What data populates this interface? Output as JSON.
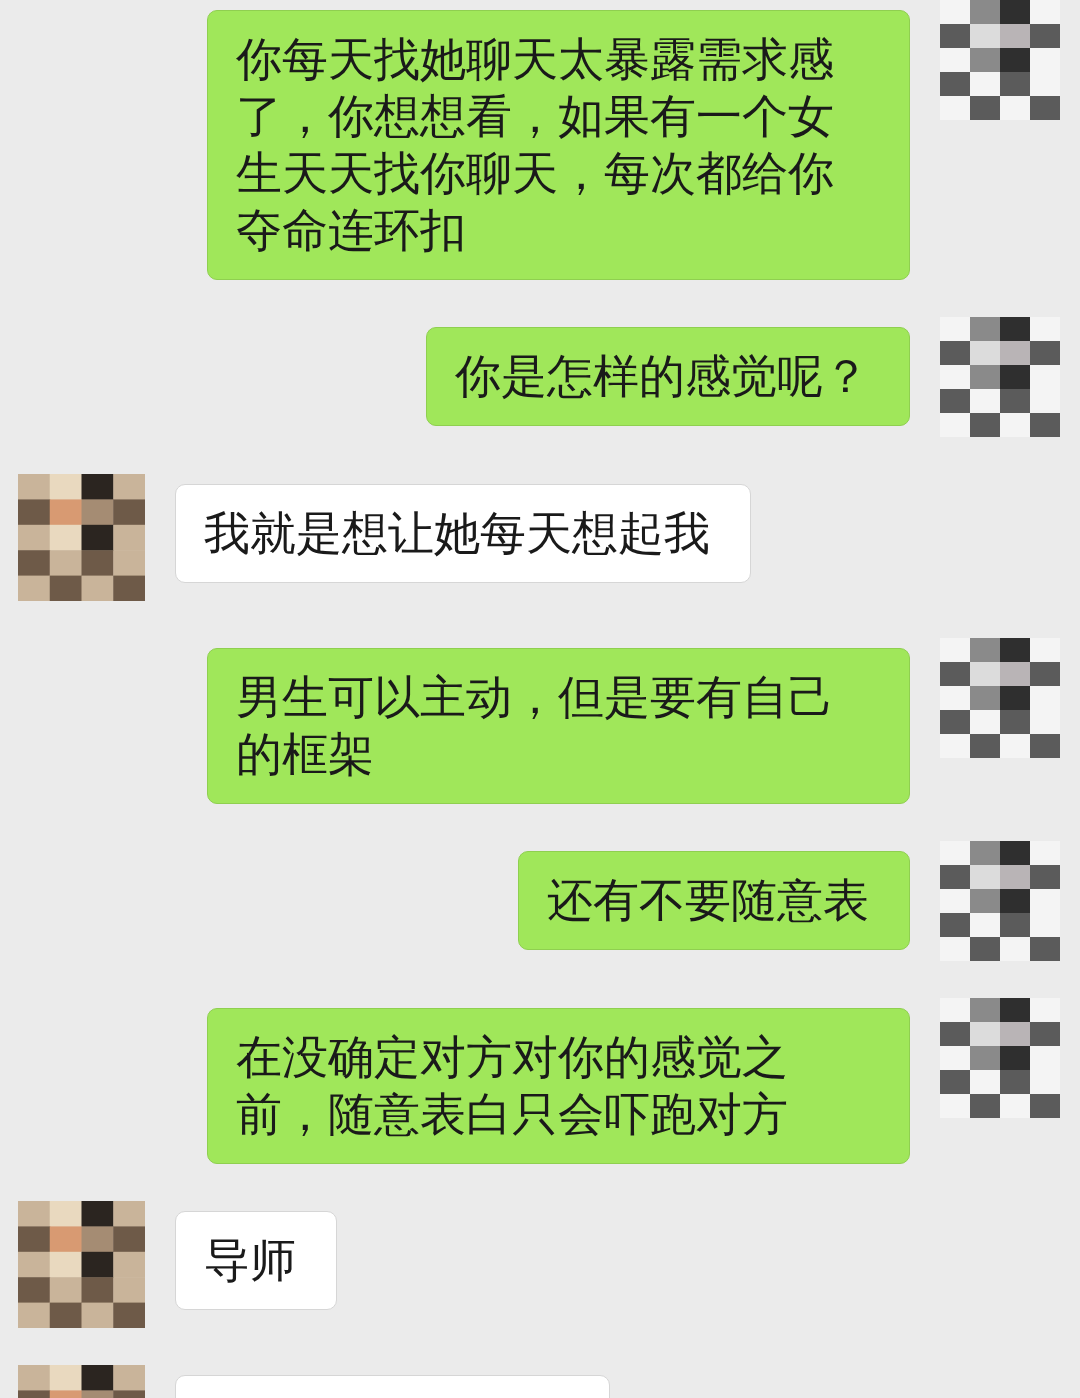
{
  "messages": [
    {
      "kind": "sent",
      "text": "你每天找她聊天太暴露需求感了，你想想看，如果有一个女生天天找你聊天，每次都给你夺命连环扣"
    },
    {
      "kind": "sent",
      "text": "你是怎样的感觉呢？"
    },
    {
      "kind": "received",
      "text": "我就是想让她每天想起我"
    },
    {
      "kind": "sent",
      "text": "男生可以主动，但是要有自己的框架"
    },
    {
      "kind": "sent",
      "text": "还有不要随意表"
    },
    {
      "kind": "sent",
      "text": "在没确定对方对你的感觉之前，随意表白只会吓跑对方"
    },
    {
      "kind": "received",
      "text": "导师"
    },
    {
      "kind": "received"
    }
  ]
}
